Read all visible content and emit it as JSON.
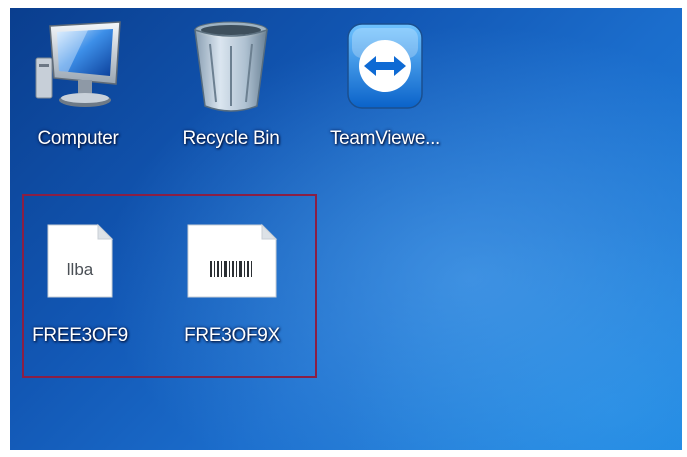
{
  "desktop": {
    "icons": [
      {
        "label": "Computer",
        "icon": "computer-icon"
      },
      {
        "label": "Recycle Bin",
        "icon": "recycle-bin-icon"
      },
      {
        "label": "TeamViewe...",
        "icon": "teamviewer-icon"
      },
      {
        "label": "FREE3OF9",
        "icon": "font-file-icon",
        "glyph_text": "llba"
      },
      {
        "label": "FRE3OF9X",
        "icon": "barcode-font-file-icon"
      }
    ]
  },
  "colors": {
    "highlight_border": "#8a1f45",
    "wallpaper": "#1b6dcc"
  }
}
